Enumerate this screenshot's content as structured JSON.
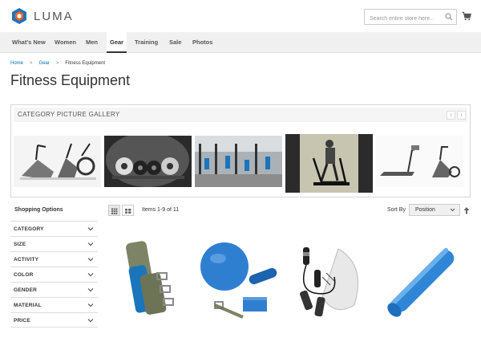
{
  "header": {
    "logo_text": "LUMA",
    "search_placeholder": "Search entire store here..."
  },
  "nav": {
    "items": [
      {
        "label": "What's New"
      },
      {
        "label": "Women"
      },
      {
        "label": "Men"
      },
      {
        "label": "Gear",
        "active": true
      },
      {
        "label": "Training"
      },
      {
        "label": "Sale"
      },
      {
        "label": "Photos"
      }
    ]
  },
  "breadcrumb": {
    "home": "Home",
    "sep1": ">",
    "gear": "Gear",
    "sep2": ">",
    "current": "Fitness Equipment"
  },
  "page_title": "Fitness Equipment",
  "gallery": {
    "title": "CATEGORY PICTURE GALLERY",
    "prev": "‹",
    "next": "›"
  },
  "toolbar": {
    "shopping_options": "Shopping Options",
    "items_count": "Items 1-9 of 11",
    "sort_label": "Sort By",
    "sort_value": "Position"
  },
  "filters": [
    {
      "label": "CATEGORY"
    },
    {
      "label": "SIZE"
    },
    {
      "label": "ACTIVITY"
    },
    {
      "label": "COLOR"
    },
    {
      "label": "GENDER"
    },
    {
      "label": "MATERIAL"
    },
    {
      "label": "PRICE"
    }
  ],
  "colors": {
    "accent": "#006bb4",
    "logo_orange": "#f26322",
    "nav_bg": "#f0f0f0"
  }
}
